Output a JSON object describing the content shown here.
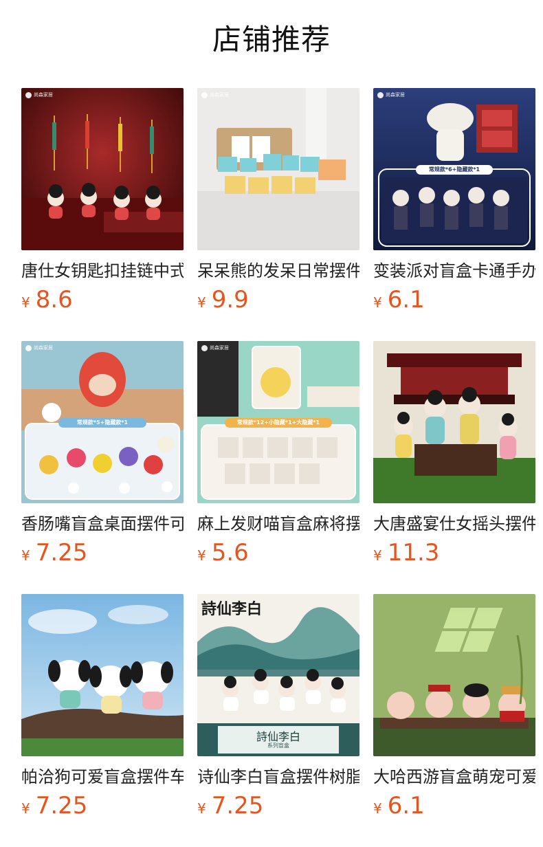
{
  "page": {
    "title": "店铺推荐"
  },
  "currency": "¥",
  "colors": {
    "price": "#e8541e"
  },
  "products": [
    {
      "title": "唐仕女钥匙扣挂链中式",
      "price": "8.6",
      "brand": "尚森家居",
      "image": "tang-lady-keychains"
    },
    {
      "title": "呆呆熊的发呆日常摆件",
      "price": "9.9",
      "brand": "尚森家居",
      "image": "bear-desk-figures"
    },
    {
      "title": "变装派对盲盒卡通手办",
      "price": "6.1",
      "brand": "尚森家居",
      "image": "costume-party-blindbox",
      "badge": "常规款*6+隐藏款*1"
    },
    {
      "title": "香肠嘴盲盒桌面摆件可爱",
      "price": "7.25",
      "brand": "尚森家居",
      "image": "sausage-mouth-blindbox",
      "badge": "常规款*5+隐藏款*1"
    },
    {
      "title": "麻上发财喵盲盒麻将摆件",
      "price": "5.6",
      "brand": "尚森家居",
      "image": "mahjong-cat-blindbox",
      "badge": "常规款*12+小隐藏*1+大隐藏*1"
    },
    {
      "title": "大唐盛宴仕女摇头摆件",
      "price": "11.3",
      "brand": "",
      "image": "tang-feast-ladies"
    },
    {
      "title": "帕洽狗可爱盲盒摆件车载",
      "price": "7.25",
      "brand": "",
      "image": "pochacco-dogs"
    },
    {
      "title": "诗仙李白盲盒摆件树脂",
      "price": "7.25",
      "brand": "",
      "image": "poet-li-bai-blindbox",
      "cover_text": "詩仙李白",
      "box_text": "詩仙李白",
      "box_sub": "系列盲盒"
    },
    {
      "title": "大哈西游盲盒萌宠可爱",
      "price": "6.1",
      "brand": "",
      "image": "journey-west-blindbox"
    }
  ]
}
